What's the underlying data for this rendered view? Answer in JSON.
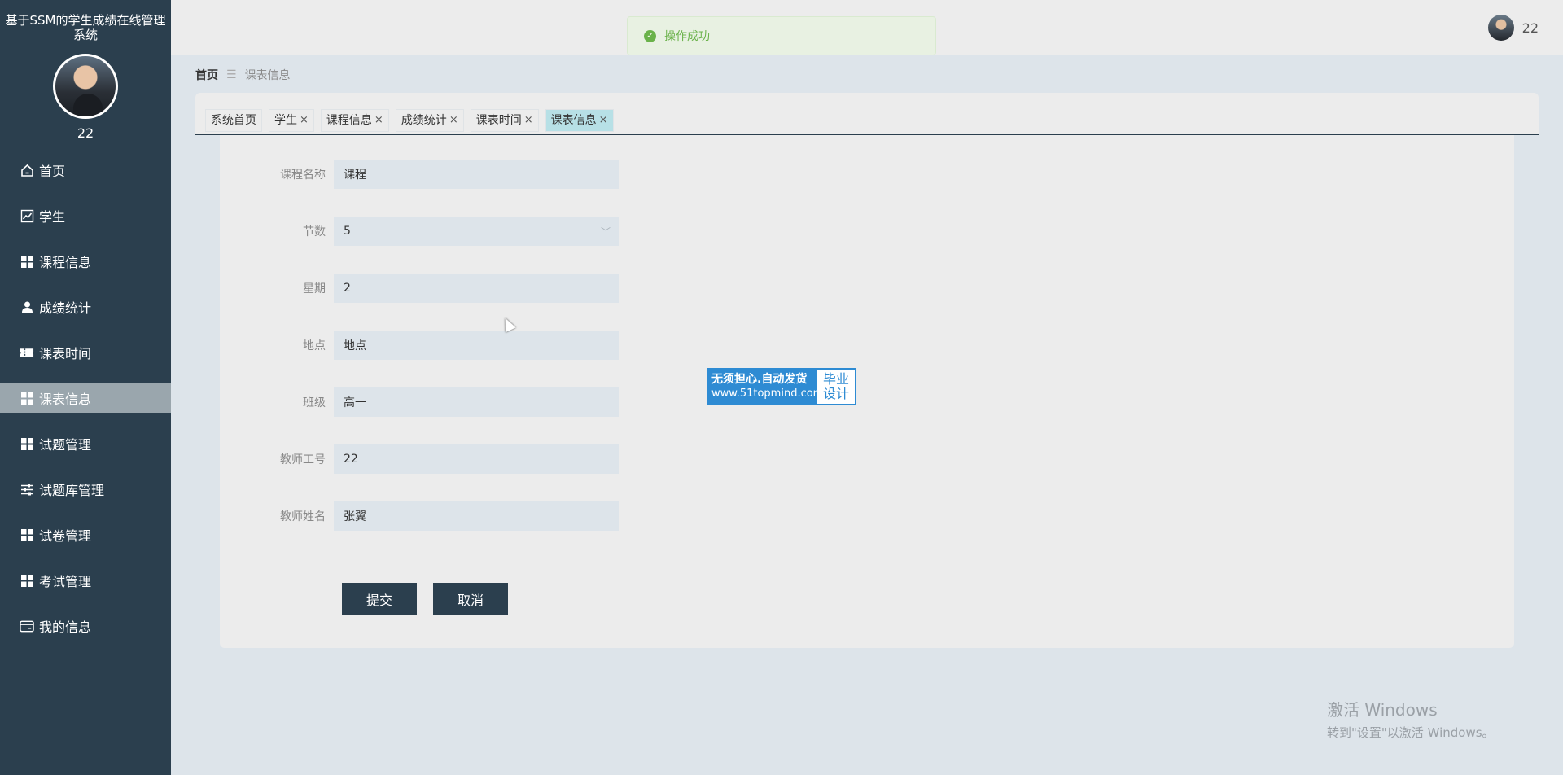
{
  "sidebar": {
    "title": "基于SSM的学生成绩在线管理系统",
    "username": "22",
    "items": [
      {
        "label": "首页",
        "icon": "home-icon"
      },
      {
        "label": "学生",
        "icon": "chart-icon"
      },
      {
        "label": "课程信息",
        "icon": "grid-icon"
      },
      {
        "label": "成绩统计",
        "icon": "user-icon"
      },
      {
        "label": "课表时间",
        "icon": "ticket-icon"
      },
      {
        "label": "课表信息",
        "icon": "grid-icon",
        "active": true
      },
      {
        "label": "试题管理",
        "icon": "grid-icon"
      },
      {
        "label": "试题库管理",
        "icon": "sliders-icon"
      },
      {
        "label": "试卷管理",
        "icon": "grid-icon"
      },
      {
        "label": "考试管理",
        "icon": "grid-icon"
      },
      {
        "label": "我的信息",
        "icon": "card-icon"
      }
    ]
  },
  "topbar": {
    "toast": "操作成功",
    "username": "22"
  },
  "breadcrumb": {
    "home": "首页",
    "current": "课表信息"
  },
  "tabs": [
    {
      "label": "系统首页",
      "closable": false
    },
    {
      "label": "学生",
      "closable": true
    },
    {
      "label": "课程信息",
      "closable": true
    },
    {
      "label": "成绩统计",
      "closable": true
    },
    {
      "label": "课表时间",
      "closable": true
    },
    {
      "label": "课表信息",
      "closable": true,
      "active": true
    }
  ],
  "form": {
    "fields": [
      {
        "label": "课程名称",
        "value": "课程"
      },
      {
        "label": "节数",
        "value": "5"
      },
      {
        "label": "星期",
        "value": "2"
      },
      {
        "label": "地点",
        "value": "地点"
      },
      {
        "label": "班级",
        "value": "高一"
      },
      {
        "label": "教师工号",
        "value": "22"
      },
      {
        "label": "教师姓名",
        "value": "张翼"
      }
    ],
    "submit_label": "提交",
    "cancel_label": "取消"
  },
  "promo": {
    "line1": "无须担心.自动发货",
    "line2": "www.51topmind.com",
    "right1": "毕业",
    "right2": "设计"
  },
  "windows_activation": {
    "line1": "激活 Windows",
    "line2": "转到\"设置\"以激活 Windows。"
  },
  "colors": {
    "sidebar_bg": "#2b3f4e",
    "active_menu": "#9aa6ad",
    "active_tab": "#b7e0e6",
    "toast_text": "#6ab24a"
  }
}
